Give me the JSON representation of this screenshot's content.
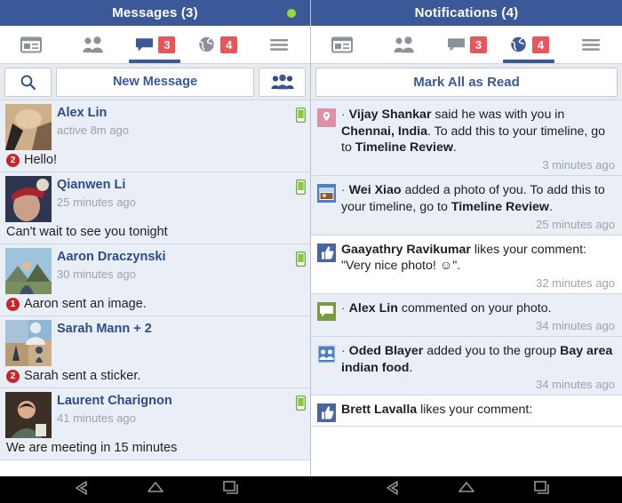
{
  "left": {
    "title": "Messages (3)",
    "online_indicator": true,
    "tabs": [
      {
        "name": "news-feed",
        "icon": "newsfeed-icon",
        "badge": null,
        "active": false
      },
      {
        "name": "friends",
        "icon": "friends-icon",
        "badge": null,
        "active": false
      },
      {
        "name": "messages",
        "icon": "message-bubble-icon",
        "badge": "3",
        "active": true
      },
      {
        "name": "notifications",
        "icon": "globe-icon",
        "badge": "4",
        "active": false
      },
      {
        "name": "menu",
        "icon": "hamburger-icon",
        "badge": null,
        "active": false
      }
    ],
    "actions": {
      "search_icon": "search-icon",
      "new_message_label": "New Message",
      "new_group_icon": "group-people-icon"
    },
    "messages": [
      {
        "name": "Alex Lin",
        "time": "active 8m ago",
        "snippet": "Hello!",
        "unread": "2",
        "mobile": true,
        "avatar": "photo-person-hat",
        "group": false
      },
      {
        "name": "Qianwen  Li",
        "time": "25 minutes ago",
        "snippet": "Can't wait to see you tonight",
        "unread": null,
        "mobile": true,
        "avatar": "photo-person-redhat",
        "group": false
      },
      {
        "name": "Aaron Draczynski",
        "time": "30 minutes ago",
        "snippet": "Aaron sent an image.",
        "unread": "1",
        "mobile": true,
        "avatar": "photo-person-hiking",
        "group": false
      },
      {
        "name": "Sarah Mann + 2",
        "time": "",
        "snippet": "Sarah sent a sticker.",
        "unread": "2",
        "mobile": false,
        "avatar": "photo-group-desert",
        "group": true
      },
      {
        "name": "Laurent Charignon",
        "time": "41 minutes ago",
        "snippet": "We are meeting in 15 minutes",
        "unread": null,
        "mobile": true,
        "avatar": "photo-person-cafe",
        "group": false
      }
    ]
  },
  "right": {
    "title": "Notifications (4)",
    "tabs": [
      {
        "name": "news-feed",
        "icon": "newsfeed-icon",
        "badge": null,
        "active": false
      },
      {
        "name": "friends",
        "icon": "friends-icon",
        "badge": null,
        "active": false
      },
      {
        "name": "messages",
        "icon": "message-bubble-icon",
        "badge": "3",
        "active": false
      },
      {
        "name": "notifications",
        "icon": "globe-icon",
        "badge": "4",
        "active": true
      },
      {
        "name": "menu",
        "icon": "hamburger-icon",
        "badge": null,
        "active": false
      }
    ],
    "actions": {
      "mark_all_label": "Mark All as Read"
    },
    "notifications": [
      {
        "icon": "location-pin-icon",
        "icon_color": "#e18fa8",
        "bullet": true,
        "time": "3 minutes ago",
        "read": false,
        "parts": [
          {
            "t": "Vijay Shankar",
            "b": true
          },
          {
            "t": " said he was with you in ",
            "b": false
          },
          {
            "t": "Chennai, India",
            "b": true
          },
          {
            "t": ". To add this to your timeline, go to ",
            "b": false
          },
          {
            "t": "Timeline Review",
            "b": true
          },
          {
            "t": ".",
            "b": false
          }
        ]
      },
      {
        "icon": "photo-icon",
        "icon_color": "#4a7fc1",
        "bullet": true,
        "time": "25 minutes ago",
        "read": false,
        "parts": [
          {
            "t": "Wei Xiao",
            "b": true
          },
          {
            "t": " added a photo of you. To add this to your timeline, go to ",
            "b": false
          },
          {
            "t": "Timeline Review",
            "b": true
          },
          {
            "t": ".",
            "b": false
          }
        ]
      },
      {
        "icon": "thumbs-up-icon",
        "icon_color": "#4a66a0",
        "bullet": false,
        "time": "32 minutes ago",
        "read": true,
        "parts": [
          {
            "t": "Gaayathry Ravikumar",
            "b": true
          },
          {
            "t": " likes your comment: \"Very nice photo! ☺\".",
            "b": false
          }
        ]
      },
      {
        "icon": "comment-bubble-icon",
        "icon_color": "#7a9a3e",
        "bullet": true,
        "time": "34 minutes ago",
        "read": false,
        "parts": [
          {
            "t": "Alex Lin",
            "b": true
          },
          {
            "t": " commented on your photo.",
            "b": false
          }
        ]
      },
      {
        "icon": "group-icon",
        "icon_color": "#4a7fc1",
        "bullet": true,
        "time": "34 minutes ago",
        "read": false,
        "parts": [
          {
            "t": "Oded Blayer",
            "b": true
          },
          {
            "t": " added you to the group ",
            "b": false
          },
          {
            "t": "Bay area indian food",
            "b": true
          },
          {
            "t": ".",
            "b": false
          }
        ]
      },
      {
        "icon": "thumbs-up-icon",
        "icon_color": "#4a66a0",
        "bullet": false,
        "time": "",
        "read": true,
        "parts": [
          {
            "t": "Brett Lavalla",
            "b": true
          },
          {
            "t": " likes your comment:",
            "b": false
          }
        ]
      }
    ]
  },
  "navbar": {
    "buttons": [
      {
        "name": "back-button",
        "icon": "back-arrow-icon"
      },
      {
        "name": "home-button",
        "icon": "home-icon"
      },
      {
        "name": "recents-button",
        "icon": "recents-icon"
      }
    ]
  },
  "colors": {
    "brand_blue": "#3b5998",
    "badge_red": "#e8565b",
    "unread_bg": "#eaeff7",
    "online_green": "#9ed63a"
  }
}
